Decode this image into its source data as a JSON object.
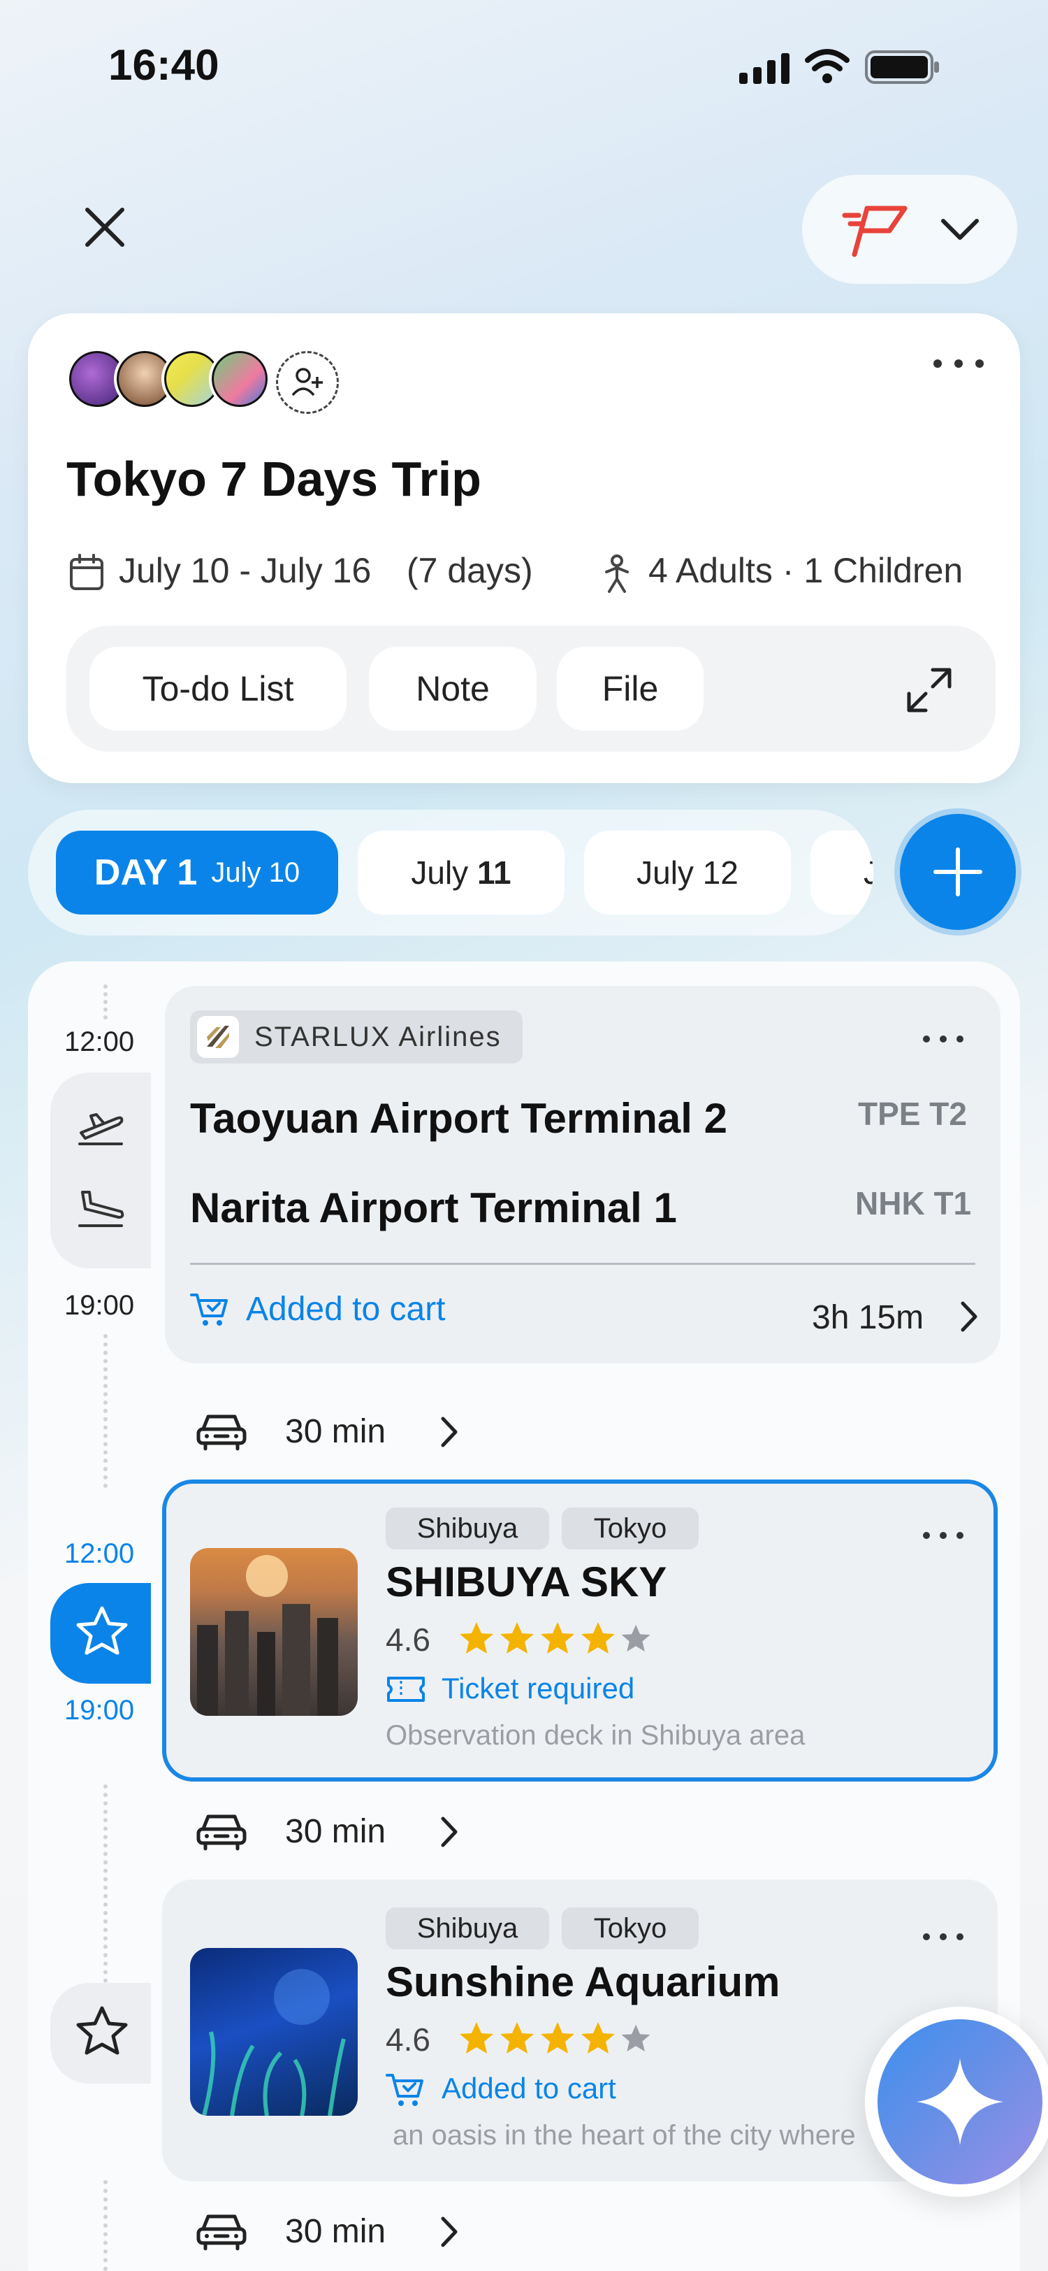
{
  "status": {
    "time": "16:40"
  },
  "trip": {
    "title": "Tokyo 7 Days Trip",
    "dates": "July 10 - July 16",
    "duration": "(7 days)",
    "travelers": "4 Adults · 1 Children"
  },
  "chips": {
    "todo": "To-do List",
    "note": "Note",
    "file": "File"
  },
  "days": {
    "day1_label": "DAY 1",
    "day1_date": "July 10",
    "d2_prefix": "July ",
    "d2_num": "11",
    "d3": "July 12",
    "d4": "J"
  },
  "timeline": {
    "flight": {
      "start": "12:00",
      "end": "19:00",
      "airline": "STARLUX Airlines",
      "from": "Taoyuan Airport Terminal 2",
      "from_code": "TPE T2",
      "to": "Narita Airport Terminal 1",
      "to_code": "NHK T1",
      "cart": "Added to cart",
      "duration": "3h 15m"
    },
    "transit1": "30 min",
    "place1": {
      "start": "12:00",
      "end": "19:00",
      "tags": [
        "Shibuya",
        "Tokyo"
      ],
      "name": "SHIBUYA SKY",
      "rating": "4.6",
      "stars": 4,
      "status": "Ticket required",
      "desc": "Observation deck in Shibuya area"
    },
    "transit2": "30 min",
    "place2": {
      "tags": [
        "Shibuya",
        "Tokyo"
      ],
      "name": "Sunshine Aquarium",
      "rating": "4.6",
      "stars": 4,
      "status": "Added to cart",
      "desc": "an oasis in the heart of the city where"
    },
    "transit3": "30 min"
  },
  "colors": {
    "accent": "#0a84e8",
    "star": "#f5b301",
    "flag": "#e8433a"
  },
  "icons": [
    "close-icon",
    "flag-icon",
    "chevron-down-icon",
    "more-icon",
    "calendar-icon",
    "person-icon",
    "expand-icon",
    "plus-icon",
    "takeoff-icon",
    "landing-icon",
    "cart-icon",
    "taxi-icon",
    "star-icon",
    "ticket-icon",
    "sparkle-icon"
  ]
}
